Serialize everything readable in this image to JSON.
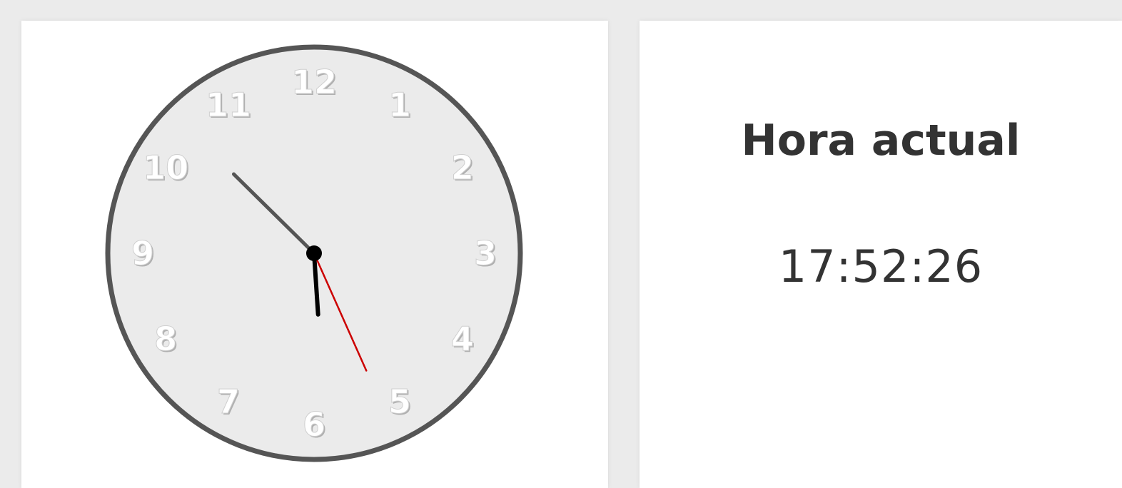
{
  "clock": {
    "time": {
      "hours": 17,
      "minutes": 52,
      "seconds": 26
    },
    "numerals": [
      "12",
      "1",
      "2",
      "3",
      "4",
      "5",
      "6",
      "7",
      "8",
      "9",
      "10",
      "11"
    ],
    "colors": {
      "face": "#ebebeb",
      "rim": "#555555",
      "numeral": "#ffffff",
      "hour_hand": "#000000",
      "minute_hand": "#555555",
      "second_hand": "#cc0000"
    }
  },
  "time_panel": {
    "title": "Hora actual",
    "value": "17:52:26"
  }
}
